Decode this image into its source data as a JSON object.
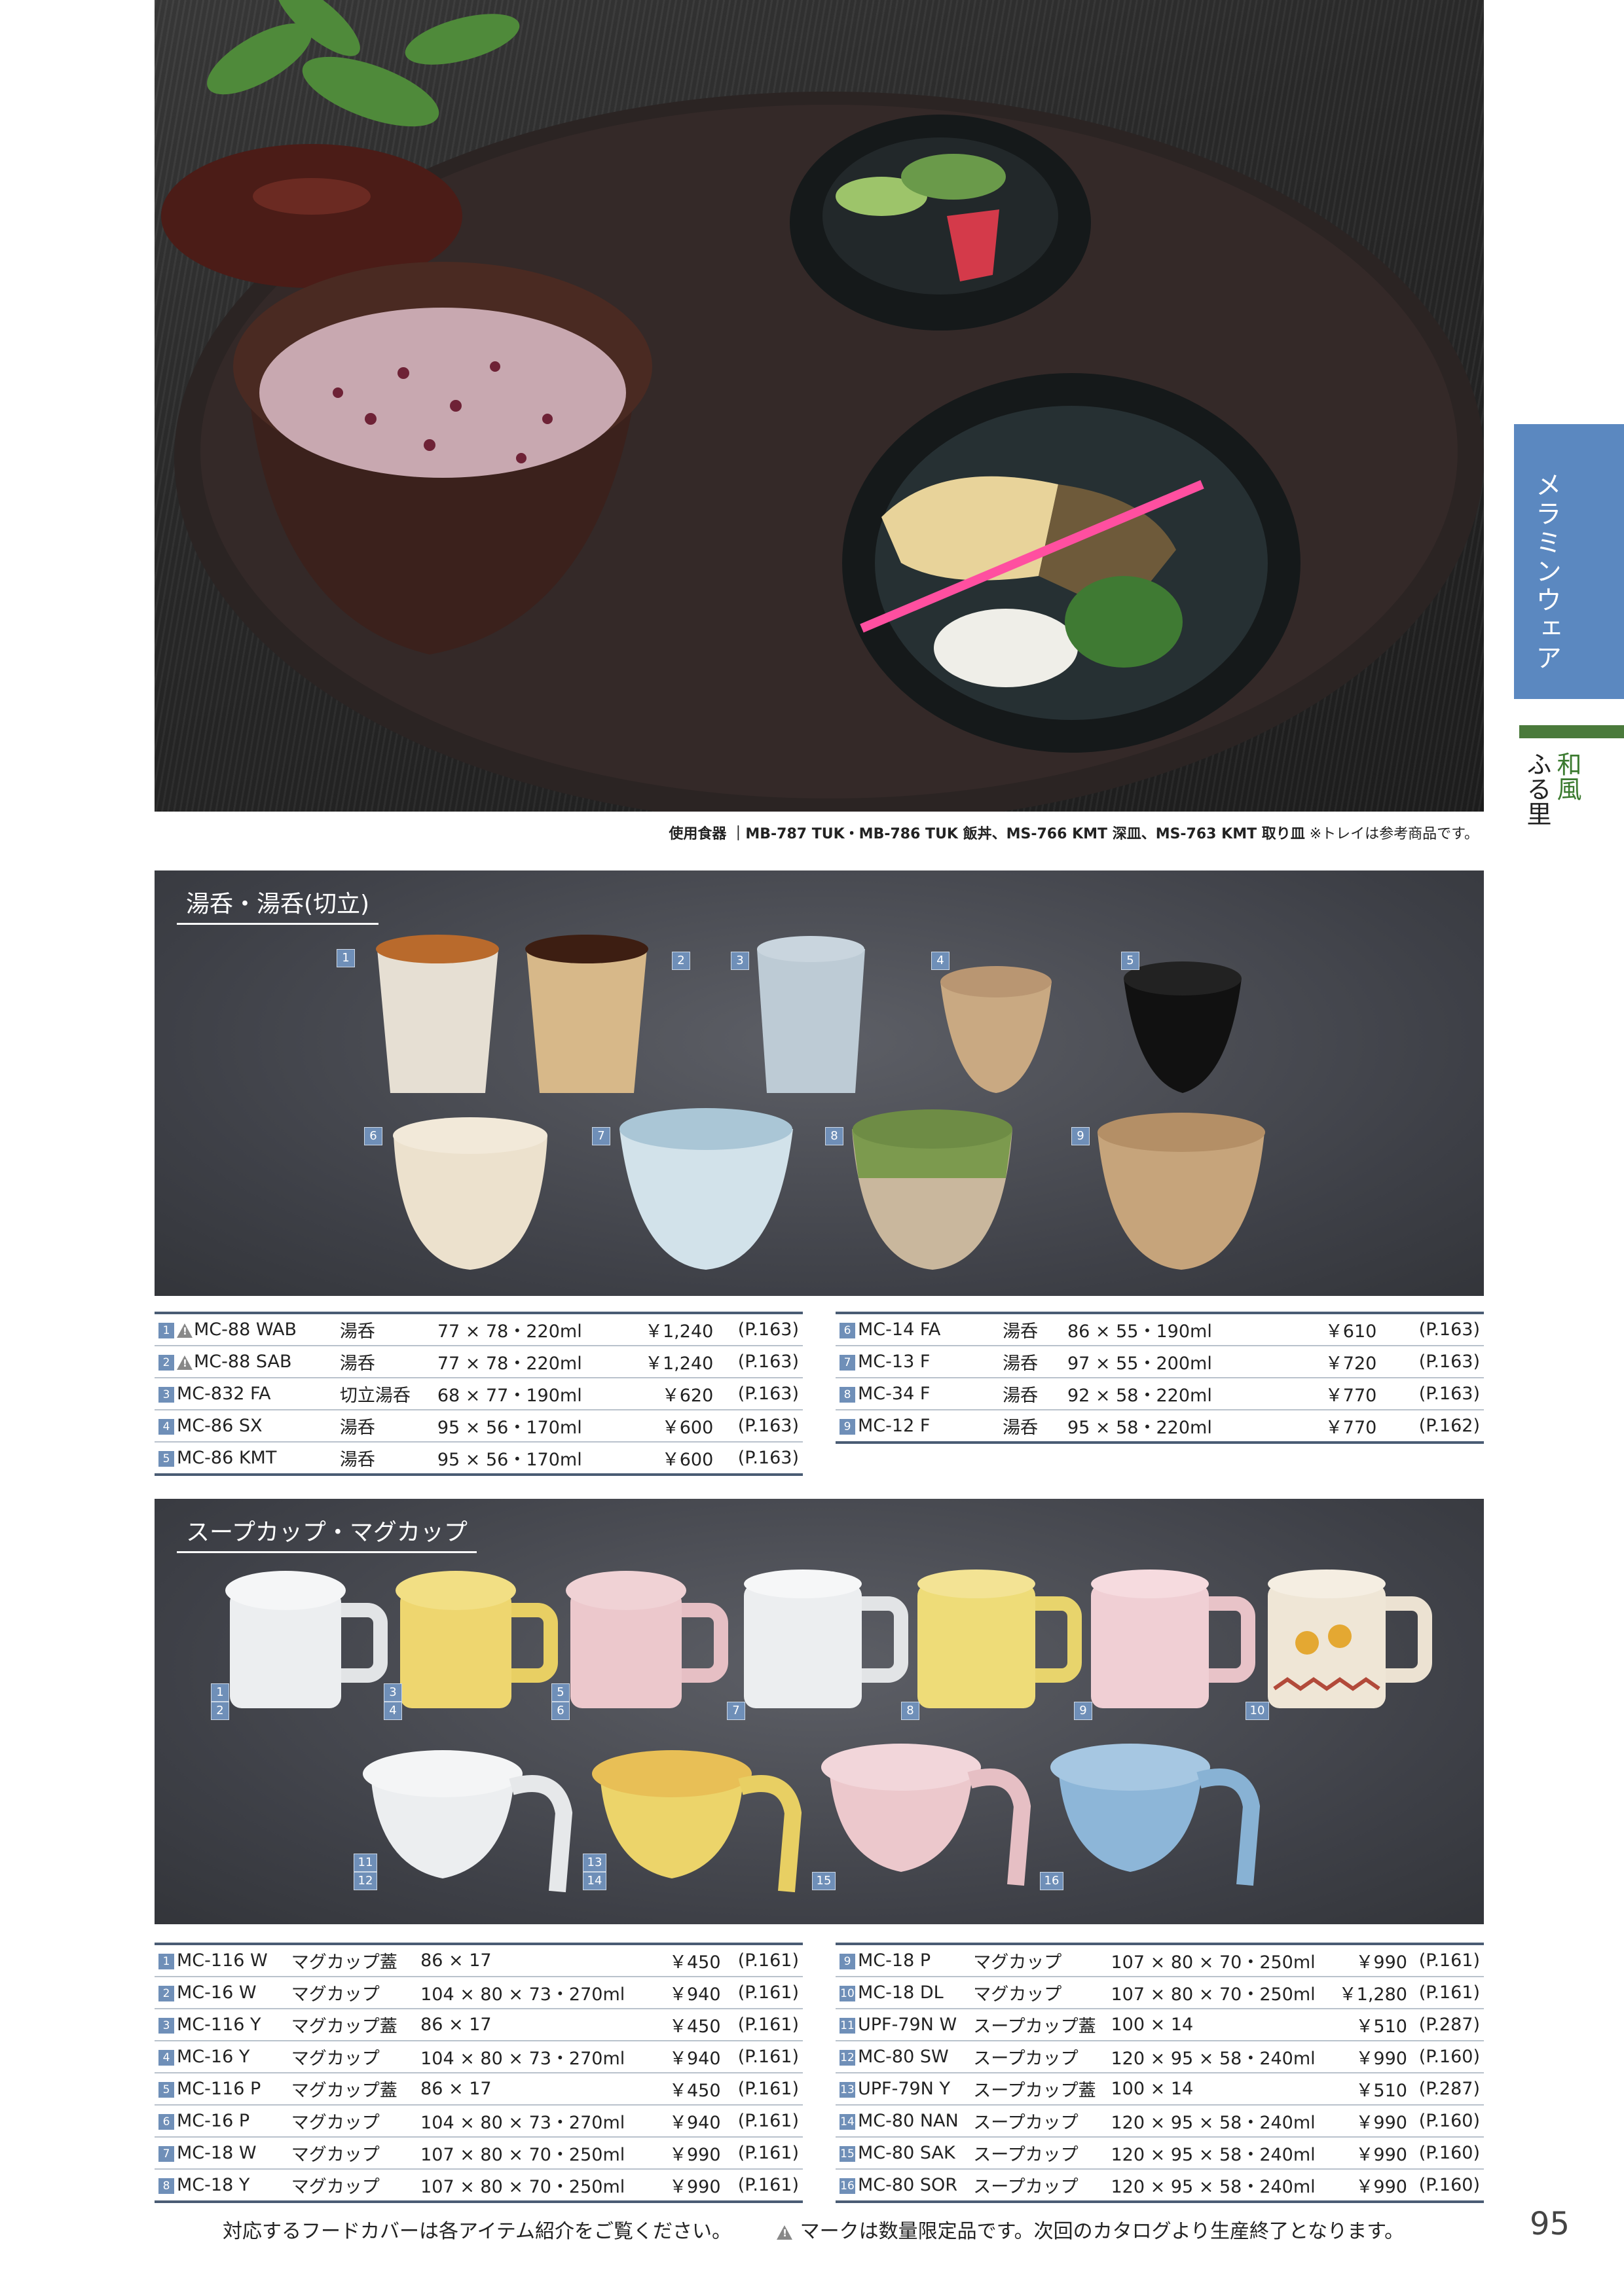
{
  "hero": {
    "caption_label": "使用食器",
    "caption_items": "｜MB-787 TUK・MB-786 TUK 飯丼、MS-766 KMT 深皿、MS-763 KMT 取り皿",
    "caption_note": "※トレイは参考商品です。"
  },
  "side": {
    "tab_label": "メラミンウェア",
    "sub_label_1": "和風",
    "sub_label_2": "ふる里"
  },
  "section1": {
    "title": "湯呑・湯呑(切立)",
    "numbers": [
      "1",
      "2",
      "3",
      "4",
      "5",
      "6",
      "7",
      "8",
      "9"
    ],
    "table_left": [
      {
        "no": "1",
        "warn": true,
        "code": "MC-88 WAB",
        "name": "湯呑",
        "size": "77 × 78・220ml",
        "price": "￥1,240",
        "page": "(P.163)"
      },
      {
        "no": "2",
        "warn": true,
        "code": "MC-88 SAB",
        "name": "湯呑",
        "size": "77 × 78・220ml",
        "price": "￥1,240",
        "page": "(P.163)"
      },
      {
        "no": "3",
        "warn": false,
        "code": "MC-832 FA",
        "name": "切立湯呑",
        "size": "68 × 77・190ml",
        "price": "￥620",
        "page": "(P.163)"
      },
      {
        "no": "4",
        "warn": false,
        "code": "MC-86 SX",
        "name": "湯呑",
        "size": "95 × 56・170ml",
        "price": "￥600",
        "page": "(P.163)"
      },
      {
        "no": "5",
        "warn": false,
        "code": "MC-86 KMT",
        "name": "湯呑",
        "size": "95 × 56・170ml",
        "price": "￥600",
        "page": "(P.163)"
      }
    ],
    "table_right": [
      {
        "no": "6",
        "code": "MC-14 FA",
        "name": "湯呑",
        "size": "86 × 55・190ml",
        "price": "￥610",
        "page": "(P.163)"
      },
      {
        "no": "7",
        "code": "MC-13 F",
        "name": "湯呑",
        "size": "97 × 55・200ml",
        "price": "￥720",
        "page": "(P.163)"
      },
      {
        "no": "8",
        "code": "MC-34 F",
        "name": "湯呑",
        "size": "92 × 58・220ml",
        "price": "￥770",
        "page": "(P.163)"
      },
      {
        "no": "9",
        "code": "MC-12 F",
        "name": "湯呑",
        "size": "95 × 58・220ml",
        "price": "￥770",
        "page": "(P.162)"
      }
    ]
  },
  "section2": {
    "title": "スープカップ・マグカップ",
    "numbers": [
      "1",
      "2",
      "3",
      "4",
      "5",
      "6",
      "7",
      "8",
      "9",
      "10",
      "11",
      "12",
      "13",
      "14",
      "15",
      "16"
    ],
    "table_left": [
      {
        "no": "1",
        "code": "MC-116 W",
        "name": "マグカップ蓋",
        "size": "86 × 17",
        "price": "￥450",
        "page": "(P.161)"
      },
      {
        "no": "2",
        "code": "MC-16 W",
        "name": "マグカップ",
        "size": "104 × 80 × 73・270ml",
        "price": "￥940",
        "page": "(P.161)"
      },
      {
        "no": "3",
        "code": "MC-116 Y",
        "name": "マグカップ蓋",
        "size": "86 × 17",
        "price": "￥450",
        "page": "(P.161)"
      },
      {
        "no": "4",
        "code": "MC-16 Y",
        "name": "マグカップ",
        "size": "104 × 80 × 73・270ml",
        "price": "￥940",
        "page": "(P.161)"
      },
      {
        "no": "5",
        "code": "MC-116 P",
        "name": "マグカップ蓋",
        "size": "86 × 17",
        "price": "￥450",
        "page": "(P.161)"
      },
      {
        "no": "6",
        "code": "MC-16 P",
        "name": "マグカップ",
        "size": "104 × 80 × 73・270ml",
        "price": "￥940",
        "page": "(P.161)"
      },
      {
        "no": "7",
        "code": "MC-18 W",
        "name": "マグカップ",
        "size": "107 × 80 × 70・250ml",
        "price": "￥990",
        "page": "(P.161)"
      },
      {
        "no": "8",
        "code": "MC-18 Y",
        "name": "マグカップ",
        "size": "107 × 80 × 70・250ml",
        "price": "￥990",
        "page": "(P.161)"
      }
    ],
    "table_right": [
      {
        "no": "9",
        "code": "MC-18 P",
        "name": "マグカップ",
        "size": "107 × 80 × 70・250ml",
        "price": "￥990",
        "page": "(P.161)"
      },
      {
        "no": "10",
        "code": "MC-18 DL",
        "name": "マグカップ",
        "size": "107 × 80 × 70・250ml",
        "price": "￥1,280",
        "page": "(P.161)"
      },
      {
        "no": "11",
        "code": "UPF-79N W",
        "name": "スープカップ蓋",
        "size": "100 × 14",
        "price": "￥510",
        "page": "(P.287)"
      },
      {
        "no": "12",
        "code": "MC-80 SW",
        "name": "スープカップ",
        "size": "120 × 95 × 58・240ml",
        "price": "￥990",
        "page": "(P.160)"
      },
      {
        "no": "13",
        "code": "UPF-79N Y",
        "name": "スープカップ蓋",
        "size": "100 × 14",
        "price": "￥510",
        "page": "(P.287)"
      },
      {
        "no": "14",
        "code": "MC-80 NAN",
        "name": "スープカップ",
        "size": "120 × 95 × 58・240ml",
        "price": "￥990",
        "page": "(P.160)"
      },
      {
        "no": "15",
        "code": "MC-80 SAK",
        "name": "スープカップ",
        "size": "120 × 95 × 58・240ml",
        "price": "￥990",
        "page": "(P.160)"
      },
      {
        "no": "16",
        "code": "MC-80 SOR",
        "name": "スープカップ",
        "size": "120 × 95 × 58・240ml",
        "price": "￥990",
        "page": "(P.160)"
      }
    ]
  },
  "footer": {
    "text_1": "対応するフードカバーは各アイテム紹介をご覧ください。",
    "text_2": "マークは数量限定品です。次回のカタログより生産終了となります。",
    "page_number": "95"
  },
  "colors": {
    "accent": "#5b88c0",
    "badge": "#6f8fb8",
    "rule": "#4a5c74",
    "green": "#4a7a3b"
  }
}
